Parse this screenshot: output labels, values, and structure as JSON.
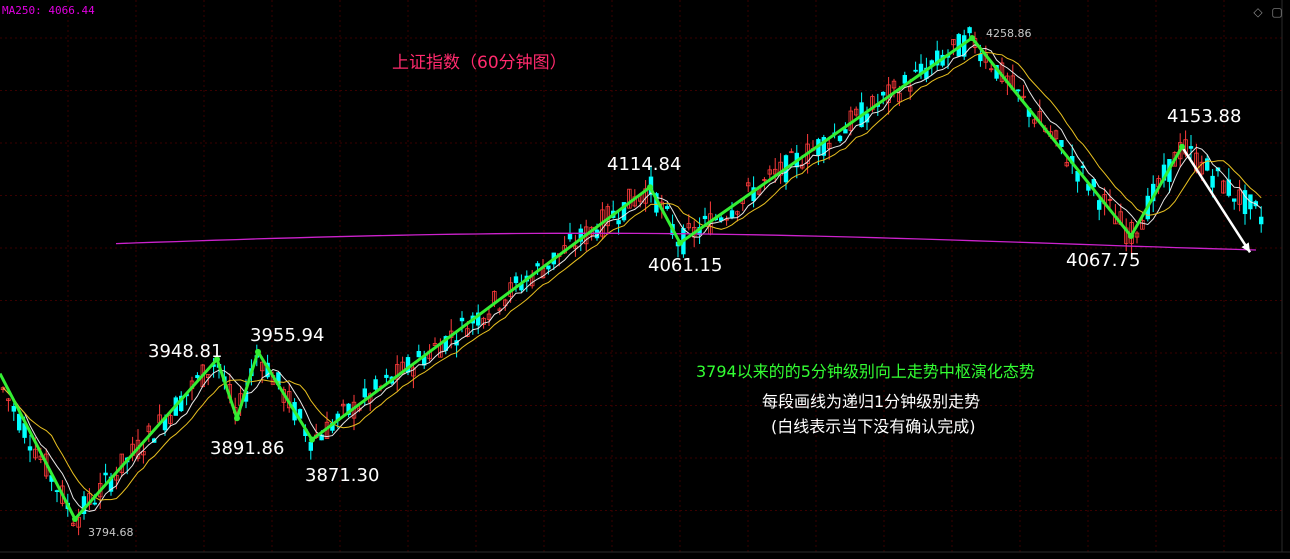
{
  "ma_label": "MA250: 4066.44",
  "corner_icons": [
    "diamond-icon",
    "window-icon"
  ],
  "annotations": {
    "title": "上证指数（60分钟图）",
    "line1": "3794以来的的5分钟级别向上走势中枢演化态势",
    "line2": "每段画线为递归1分钟级别走势",
    "line3": "(白线表示当下没有确认完成)"
  },
  "colors": {
    "background": "#000000",
    "up_candle": "#ff3b3b",
    "down_candle": "#00ffff",
    "segment_line": "#33ee33",
    "pending_line": "#ffffff",
    "ma250": "#cc22cc",
    "ma_white": "#e8e8e8",
    "ma_yellow": "#e8c020",
    "grid": "#3a0000"
  },
  "chart_data": {
    "type": "line",
    "y_range": [
      3770,
      4275
    ],
    "pivots": [
      {
        "label": "3794.68",
        "value": 3794.68,
        "style": "small"
      },
      {
        "label": "3948.81",
        "value": 3948.81,
        "style": "big"
      },
      {
        "label": "3891.86",
        "value": 3891.86,
        "style": "big"
      },
      {
        "label": "3955.94",
        "value": 3955.94,
        "style": "big"
      },
      {
        "label": "3871.30",
        "value": 3871.3,
        "style": "big"
      },
      {
        "label": "4114.84",
        "value": 4114.84,
        "style": "big"
      },
      {
        "label": "4061.15",
        "value": 4061.15,
        "style": "big"
      },
      {
        "label": "4258.86",
        "value": 4258.86,
        "style": "small"
      },
      {
        "label": "4067.75",
        "value": 4067.75,
        "style": "big"
      },
      {
        "label": "4153.88",
        "value": 4153.88,
        "style": "big"
      }
    ],
    "ma250_value": 4066.44,
    "grid": true
  }
}
